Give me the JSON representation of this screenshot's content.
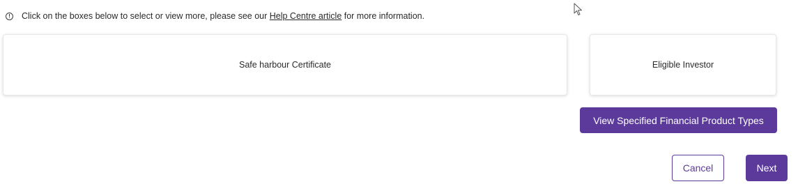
{
  "info": {
    "icon": "info-circle-icon",
    "text_before": "Click on the boxes below to select or view more, please see our",
    "link_text": "Help Centre article",
    "text_after": "for more information."
  },
  "cards": [
    {
      "label": "Safe harbour Certificate"
    },
    {
      "label": "Eligible Investor"
    }
  ],
  "buttons": {
    "view_types": "View Specified Financial Product Types",
    "cancel": "Cancel",
    "next": "Next"
  },
  "colors": {
    "accent": "#5b3a9c",
    "text": "#2a2a2a",
    "card_border": "#e7e7e7"
  },
  "cursor": {
    "icon": "mouse-pointer-icon"
  }
}
